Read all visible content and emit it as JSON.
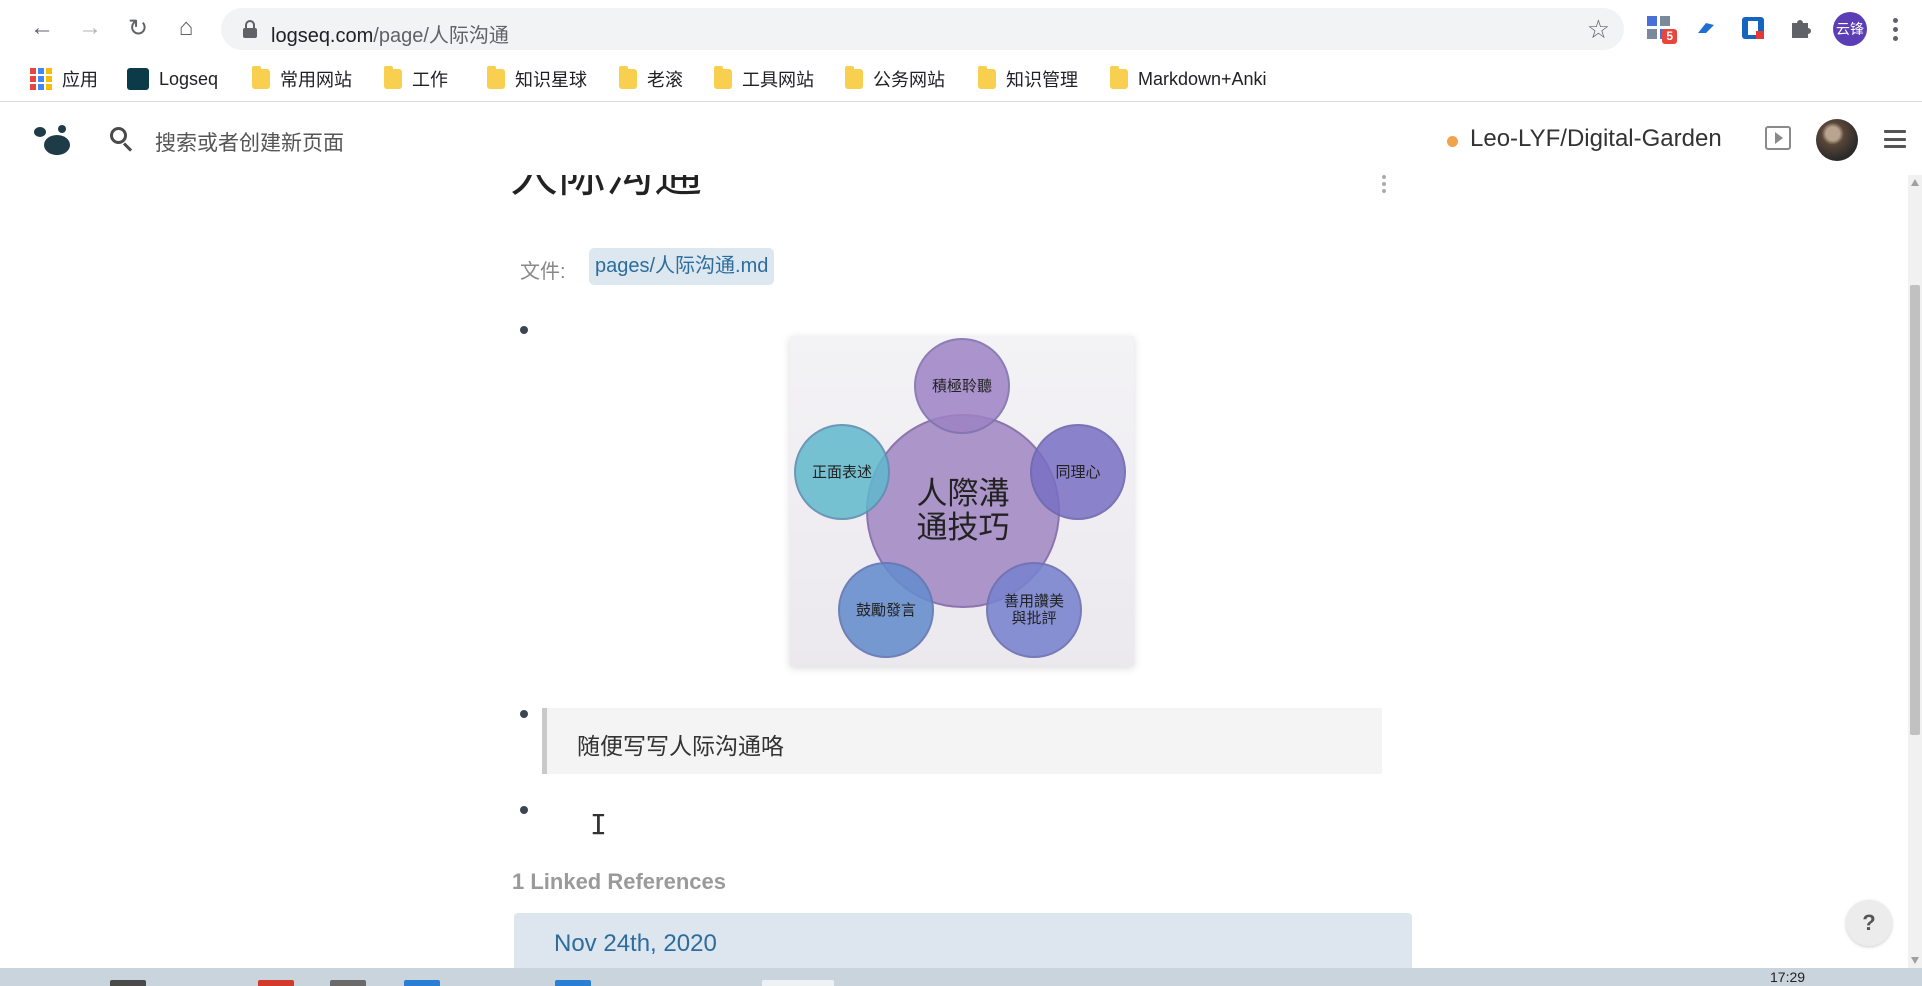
{
  "browser": {
    "url_host": "logseq.com",
    "url_path": "/page/人际沟通",
    "extensions": [
      {
        "name": "extension-app-icon",
        "badge": "5"
      },
      {
        "name": "extension-translate-icon"
      },
      {
        "name": "extension-dictionary-icon"
      },
      {
        "name": "extensions-puzzle-icon"
      }
    ],
    "profile_label": "云锋"
  },
  "bookmarks": [
    {
      "label": "应用",
      "icon": "apps-grid-icon"
    },
    {
      "label": "Logseq",
      "icon": "logseq-icon"
    },
    {
      "label": "常用网站",
      "icon": "folder-icon"
    },
    {
      "label": "工作",
      "icon": "folder-icon"
    },
    {
      "label": "知识星球",
      "icon": "folder-icon"
    },
    {
      "label": "老滚",
      "icon": "folder-icon"
    },
    {
      "label": "工具网站",
      "icon": "folder-icon"
    },
    {
      "label": "公务网站",
      "icon": "folder-icon"
    },
    {
      "label": "知识管理",
      "icon": "folder-icon"
    },
    {
      "label": "Markdown+Anki",
      "icon": "folder-icon"
    }
  ],
  "header": {
    "search_placeholder": "搜索或者创建新页面",
    "repo_name": "Leo-LYF/Digital-Garden",
    "repo_status_color": "#f0a34a"
  },
  "page": {
    "title": "人际沟通",
    "file_label": "文件:",
    "file_path": "pages/人际沟通.md",
    "image": {
      "center": [
        "人際溝",
        "通技巧"
      ],
      "top": "積極聆聽",
      "left": "正面表述",
      "right": "同理心",
      "bottom_left": "鼓勵發言",
      "bottom_right": [
        "善用讚美",
        "與批評"
      ]
    },
    "quote": "随便写写人际沟通咯",
    "references_title": "1 Linked References",
    "reference_date": "Nov 24th, 2020"
  },
  "help": "?",
  "clock": "17:29",
  "colors": {
    "link": "#2c6d9e",
    "accent": "#f0a34a"
  }
}
